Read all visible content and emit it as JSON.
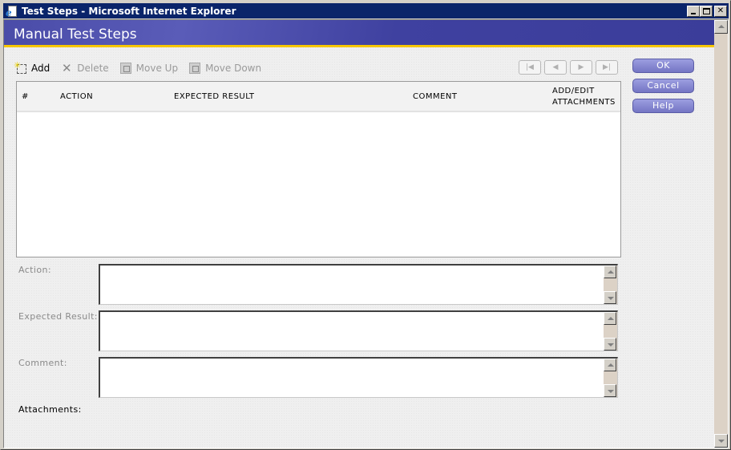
{
  "window": {
    "title": "Test Steps - Microsoft Internet Explorer",
    "controls": [
      "minimize",
      "maximize",
      "close"
    ]
  },
  "header": {
    "title": "Manual Test Steps"
  },
  "toolbar": {
    "add": "Add",
    "delete": "Delete",
    "move_up": "Move Up",
    "move_down": "Move Down"
  },
  "pager": [
    "first",
    "previous",
    "next",
    "last"
  ],
  "grid": {
    "columns": [
      "#",
      "ACTION",
      "EXPECTED RESULT",
      "COMMENT",
      "ADD/EDIT",
      "ATTACHMENTS"
    ],
    "rows": []
  },
  "form": {
    "action_label": "Action:",
    "expected_label": "Expected Result:",
    "comment_label": "Comment:",
    "attachments_label": "Attachments:",
    "action_value": "",
    "expected_value": "",
    "comment_value": ""
  },
  "buttons": {
    "ok": "OK",
    "cancel": "Cancel",
    "help": "Help"
  },
  "colors": {
    "titlebar": "#0a246a",
    "header": "#4a4ca8",
    "accent": "#f7c600",
    "button": "#8485d2"
  }
}
